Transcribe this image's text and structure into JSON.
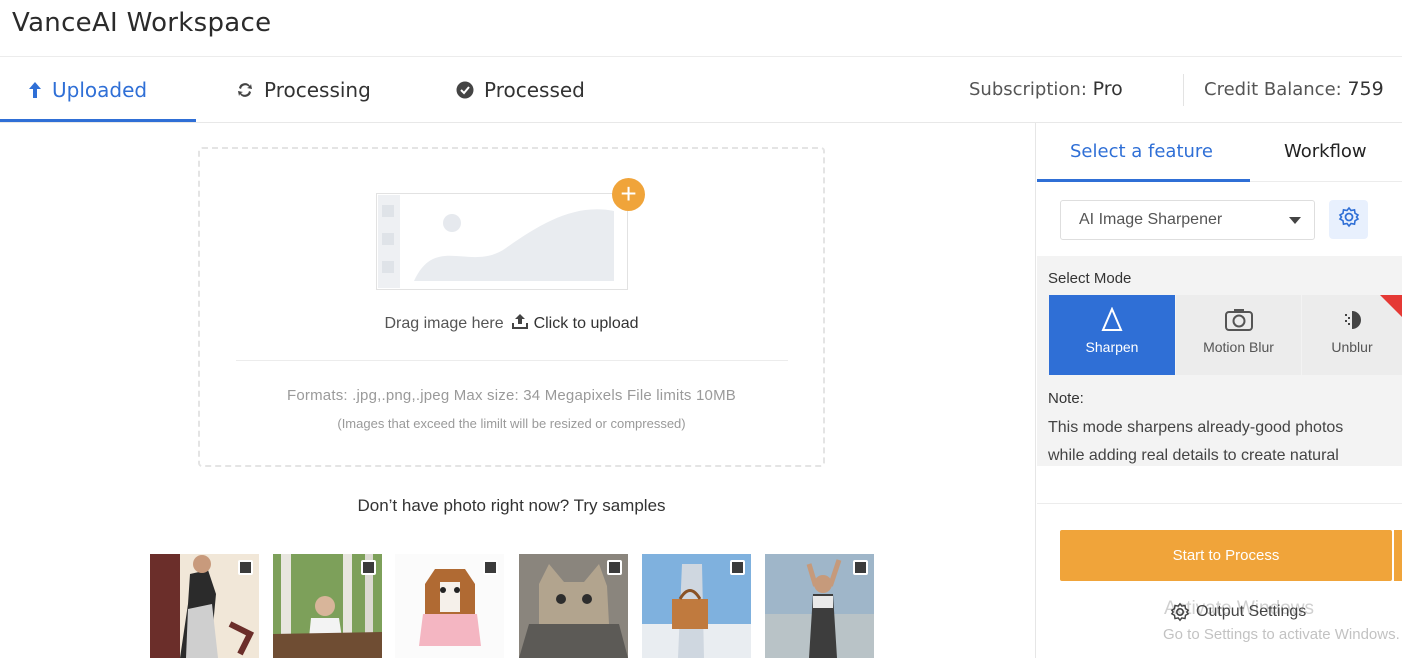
{
  "app": {
    "title": "VanceAI Workspace"
  },
  "tabs": [
    {
      "label": "Uploaded",
      "icon": "arrow-up-icon",
      "active": true
    },
    {
      "label": "Processing",
      "icon": "refresh-icon",
      "active": false
    },
    {
      "label": "Processed",
      "icon": "check-circle-icon",
      "active": false
    }
  ],
  "account": {
    "subscription_label": "Subscription:",
    "subscription_value": "Pro",
    "credit_label": "Credit Balance:",
    "credit_value": "759"
  },
  "upload": {
    "drag_text": "Drag image here",
    "click_text": "Click to upload",
    "formats_text": "Formats: .jpg,.png,.jpeg Max size: 34 Megapixels File limits 10MB",
    "resize_note": "(Images that exceed the limilt will be resized or compressed)",
    "samples_text": "Don’t have photo right now? Try samples",
    "plus_symbol": "+"
  },
  "samples": [
    {
      "name": "sample-dancer"
    },
    {
      "name": "sample-girl-birches"
    },
    {
      "name": "sample-dog"
    },
    {
      "name": "sample-cat"
    },
    {
      "name": "sample-bag"
    },
    {
      "name": "sample-woman-beach"
    }
  ],
  "panel": {
    "tabs": [
      {
        "label": "Select a feature",
        "active": true
      },
      {
        "label": "Workflow",
        "active": false
      }
    ],
    "feature_select": "AI Image Sharpener",
    "select_mode_label": "Select Mode",
    "modes": [
      {
        "label": "Sharpen",
        "icon": "sharpen-icon",
        "active": true
      },
      {
        "label": "Motion Blur",
        "icon": "camera-icon",
        "active": false
      },
      {
        "label": "Unblur",
        "icon": "unblur-icon",
        "active": false
      }
    ],
    "note_title": "Note:",
    "note_line1": "This mode sharpens already-good photos",
    "note_line2": "while adding real details to create natural",
    "start_button": "Start to Process",
    "output_settings": "Output Settings"
  },
  "watermark": {
    "line1": "Activate Windows",
    "line2": "Go to Settings to activate Windows."
  },
  "colors": {
    "accent": "#2f6fd6",
    "orange": "#f0a43a",
    "badge": "#e53935"
  }
}
